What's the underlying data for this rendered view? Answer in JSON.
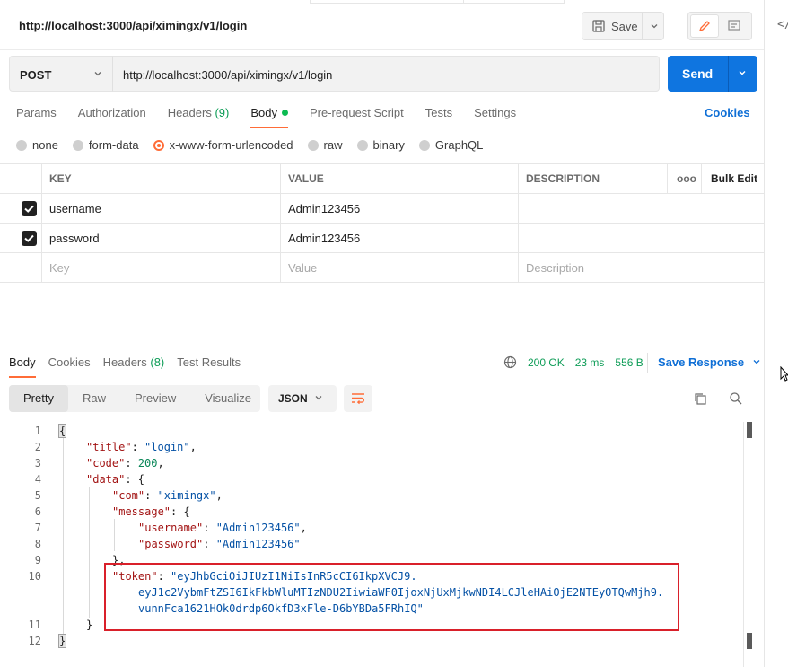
{
  "header": {
    "title": "http://localhost:3000/api/ximingx/v1/login",
    "save_label": "Save"
  },
  "request": {
    "method": "POST",
    "url": "http://localhost:3000/api/ximingx/v1/login",
    "send_label": "Send",
    "tabs": [
      {
        "label": "Params"
      },
      {
        "label": "Authorization"
      },
      {
        "label": "Headers",
        "count": "(9)"
      },
      {
        "label": "Body"
      },
      {
        "label": "Pre-request Script"
      },
      {
        "label": "Tests"
      },
      {
        "label": "Settings"
      }
    ],
    "cookies_label": "Cookies",
    "body_types": [
      "none",
      "form-data",
      "x-www-form-urlencoded",
      "raw",
      "binary",
      "GraphQL"
    ],
    "selected_body_type": "x-www-form-urlencoded",
    "table": {
      "headers": {
        "key": "KEY",
        "value": "VALUE",
        "description": "DESCRIPTION",
        "more": "ooo",
        "bulk": "Bulk Edit"
      },
      "rows": [
        {
          "checked": true,
          "key": "username",
          "value": "Admin123456",
          "description": ""
        },
        {
          "checked": true,
          "key": "password",
          "value": "Admin123456",
          "description": ""
        }
      ],
      "placeholder": {
        "key": "Key",
        "value": "Value",
        "description": "Description"
      }
    }
  },
  "response": {
    "tabs": [
      {
        "label": "Body"
      },
      {
        "label": "Cookies"
      },
      {
        "label": "Headers",
        "count": "(8)"
      },
      {
        "label": "Test Results"
      }
    ],
    "status": "200 OK",
    "time": "23 ms",
    "size": "556 B",
    "save_label": "Save Response",
    "view_tabs": [
      "Pretty",
      "Raw",
      "Preview",
      "Visualize"
    ],
    "format": "JSON",
    "line_numbers": [
      "1",
      "2",
      "3",
      "4",
      "5",
      "6",
      "7",
      "8",
      "9",
      "10",
      "11",
      "12"
    ],
    "json": {
      "title_key": "\"title\"",
      "title_val": "\"login\"",
      "code_key": "\"code\"",
      "code_val": "200",
      "data_key": "\"data\"",
      "com_key": "\"com\"",
      "com_val": "\"ximingx\"",
      "message_key": "\"message\"",
      "username_key": "\"username\"",
      "username_val": "\"Admin123456\"",
      "password_key": "\"password\"",
      "password_val": "\"Admin123456\"",
      "token_key": "\"token\"",
      "token_line1": "\"eyJhbGciOiJIUzI1NiIsInR5cCI6IkpXVCJ9.",
      "token_line2": "eyJ1c2VybmFtZSI6IkFkbWluMTIzNDU2IiwiaWF0IjoxNjUxMjkwNDI4LCJleHAiOjE2NTEyOTQwMjh9.",
      "token_line3": "vunnFca1621HOk0drdp6OkfD3xFle-D6bYBDa5FRhIQ\""
    }
  },
  "side_panel_code": "</",
  "colors": {
    "accent": "#ff6c37",
    "send": "#0f75e0",
    "link": "#0f6fd6",
    "status": "#0f9d58",
    "highlight": "#d9202a"
  }
}
